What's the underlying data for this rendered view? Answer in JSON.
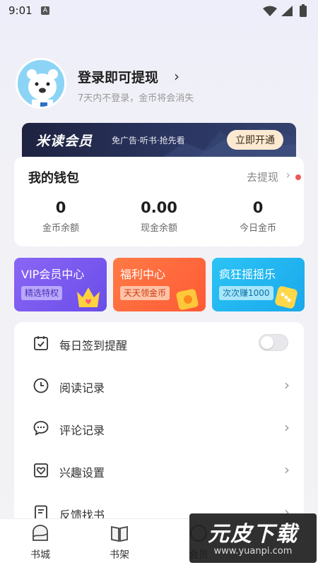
{
  "status_bar": {
    "time": "9:01",
    "notification_badge": "A"
  },
  "profile": {
    "login_title": "登录即可提现",
    "login_chevron": "›",
    "login_subtitle": "7天内不登录，金币将会消失"
  },
  "vip_banner": {
    "title": "米读会员",
    "subtitle": "免广告·听书·抢先看",
    "button": "立即开通"
  },
  "wallet": {
    "title": "我的钱包",
    "withdraw_link": "去提现",
    "chevron": "›",
    "stats": [
      {
        "value": "0",
        "label": "金币余额"
      },
      {
        "value": "0.00",
        "label": "现金余额"
      },
      {
        "value": "0",
        "label": "今日金币"
      }
    ]
  },
  "features": [
    {
      "title": "VIP会员中心",
      "tag": "精选特权",
      "color": "#7a5cf0"
    },
    {
      "title": "福利中心",
      "tag": "天天领金币",
      "color": "#ff6a3d"
    },
    {
      "title": "疯狂摇摇乐",
      "tag": "次次赚1000",
      "color": "#22b6f0"
    }
  ],
  "menu": [
    {
      "label": "每日签到提醒",
      "icon": "calendar-check-icon",
      "control": "toggle",
      "toggle_on": false
    },
    {
      "label": "阅读记录",
      "icon": "clock-icon",
      "control": "chevron"
    },
    {
      "label": "评论记录",
      "icon": "comment-icon",
      "control": "chevron"
    },
    {
      "label": "兴趣设置",
      "icon": "heart-frame-icon",
      "control": "chevron"
    },
    {
      "label": "反馈找书",
      "icon": "document-icon",
      "control": "chevron"
    }
  ],
  "menu_chevron": "›",
  "bottom_nav": [
    {
      "label": "书城",
      "icon": "bookstore-icon"
    },
    {
      "label": "书架",
      "icon": "bookshelf-icon"
    },
    {
      "label": "会员",
      "icon": "vip-icon"
    }
  ],
  "watermark": {
    "text": "元皮下载",
    "url": "www.yuanpi.com"
  }
}
